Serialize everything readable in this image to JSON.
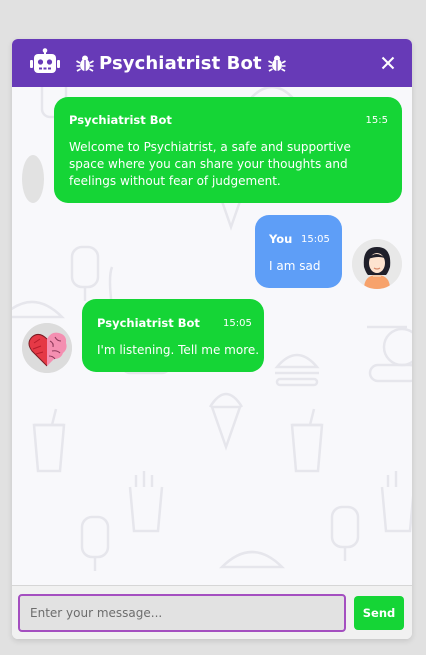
{
  "header": {
    "title": "Psychiatrist Bot",
    "bot_icon": "robot-icon",
    "emoji_icon": "bug-icon",
    "close_icon": "close-icon",
    "color": "#673ab7"
  },
  "messages": [
    {
      "sender": "Psychiatrist Bot",
      "time": "15:5",
      "text": "Welcome to Psychiatrist, a safe and supportive space where you can share your thoughts and feelings without fear of judgement.",
      "color": "#15d536"
    },
    {
      "sender": "You",
      "time": "15:05",
      "text": "I am sad",
      "color": "#5e9ef7"
    },
    {
      "sender": "Psychiatrist Bot",
      "time": "15:05",
      "text": "I'm listening. Tell me more.",
      "color": "#15d536"
    }
  ],
  "composer": {
    "placeholder": "Enter your message...",
    "value": "",
    "send_label": "Send",
    "accent": "#a44fc0"
  }
}
